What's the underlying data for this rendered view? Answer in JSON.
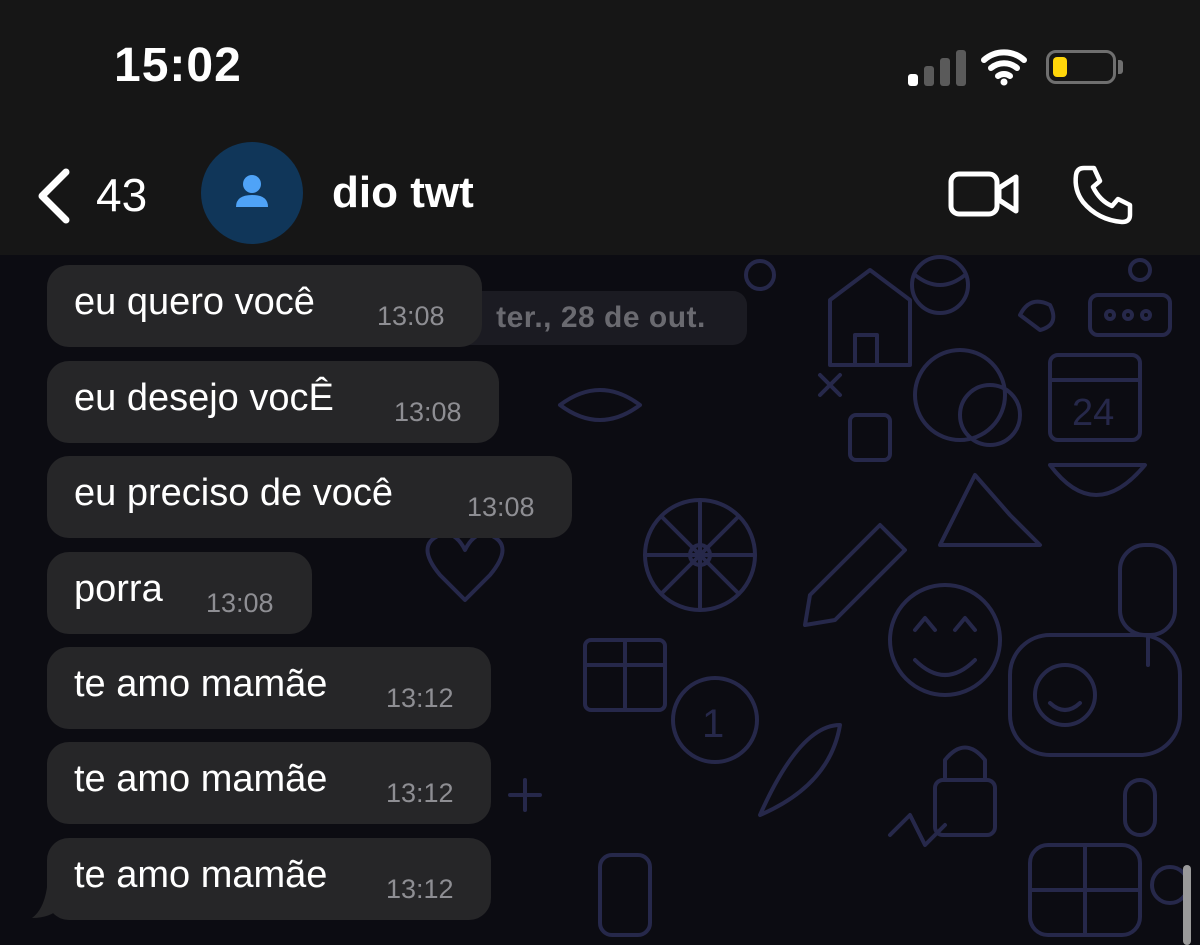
{
  "status_bar": {
    "time": "15:02",
    "signal_bars_active": 1,
    "signal_bars_total": 4,
    "battery_level": 0.25,
    "battery_color": "#ffd60a"
  },
  "header": {
    "back_count": "43",
    "contact_name": "dio twt",
    "avatar_color": "#103659",
    "avatar_icon_color": "#4fa3f7",
    "icons": [
      "chevron-left-icon",
      "person-icon",
      "video-camera-icon",
      "phone-icon"
    ]
  },
  "chat": {
    "date_label": "ter., 28 de out.",
    "bubble_color": "#262628",
    "messages": [
      {
        "text": "eu quero você",
        "time": "13:08"
      },
      {
        "text": "eu desejo vocÊ",
        "time": "13:08"
      },
      {
        "text": "eu preciso de você",
        "time": "13:08"
      },
      {
        "text": "porra",
        "time": "13:08"
      },
      {
        "text": "te amo mamãe",
        "time": "13:12"
      },
      {
        "text": "te amo mamãe",
        "time": "13:12"
      },
      {
        "text": "te amo mamãe",
        "time": "13:12"
      }
    ]
  }
}
